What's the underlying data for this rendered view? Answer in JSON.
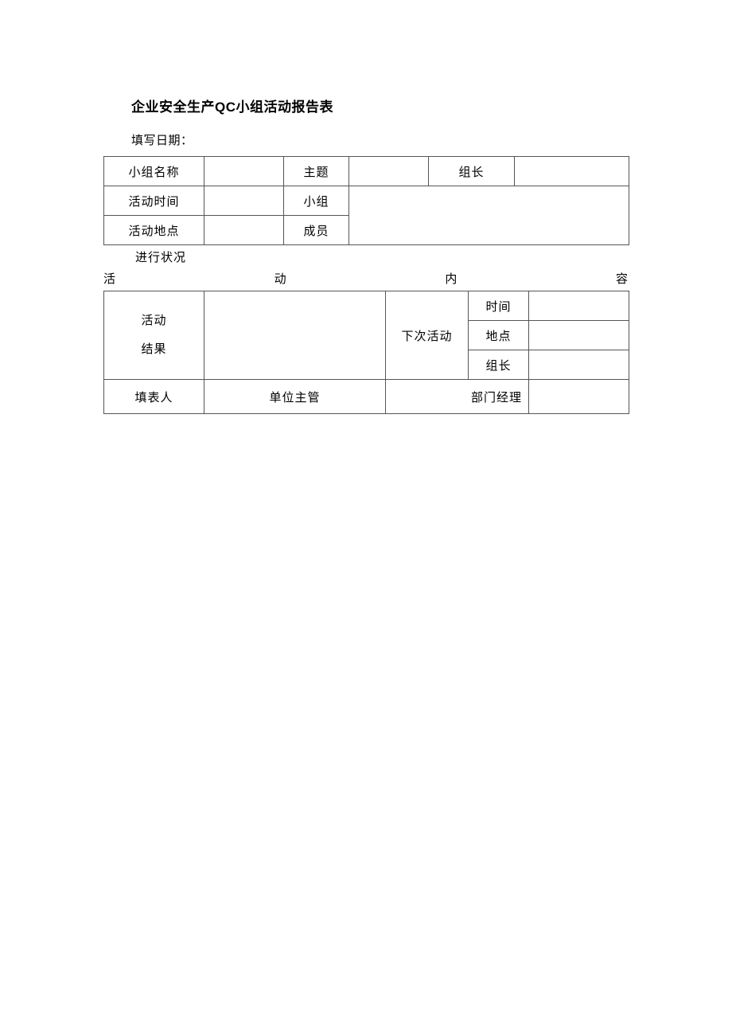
{
  "title": "企业安全生产QC小组活动报告表",
  "fill_date_label": "填写日期：",
  "table1": {
    "group_name": "小组名称",
    "topic": "主题",
    "leader": "组长",
    "activity_time": "活动时间",
    "group": "小组",
    "activity_place": "活动地点",
    "members": "成员"
  },
  "status_label": "进行状况",
  "content_heading": {
    "c1": "活",
    "c2": "动",
    "c3": "内",
    "c4": "容"
  },
  "table2": {
    "activity": "活动",
    "result": "结果",
    "next_activity": "下次活动",
    "time": "时间",
    "place": "地点",
    "leader": "组长",
    "filler": "填表人",
    "unit_supervisor": "单位主管",
    "dept_manager": "部门经理"
  }
}
